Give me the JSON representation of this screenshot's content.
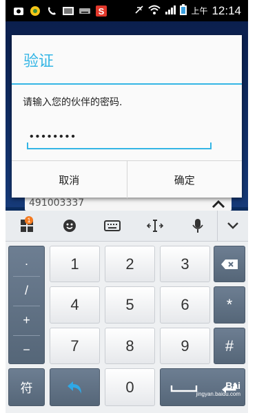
{
  "status_bar": {
    "left_icons": [
      "camera-icon",
      "sync-icon",
      "phone-icon",
      "image-icon",
      "keyboard-icon",
      "s-app-icon"
    ],
    "ampm": "上午",
    "time": "12:14"
  },
  "background": {
    "behind_input_value": "491003337"
  },
  "dialog": {
    "title": "验证",
    "message": "请输入您的伙伴的密码.",
    "password_value": "••••••••",
    "cancel_label": "取消",
    "confirm_label": "确定"
  },
  "keyboard": {
    "toolbar_badge": "1",
    "symbols": [
      ".",
      "/",
      "+",
      "−"
    ],
    "digits": [
      "1",
      "2",
      "3",
      "4",
      "5",
      "6",
      "7",
      "8",
      "9",
      "0"
    ],
    "star": "*",
    "hash": "#",
    "sym_label": "符"
  },
  "watermark": {
    "main": "Bai",
    "sub": "jingyan.baidu.com"
  },
  "colors": {
    "accent": "#33b5e5",
    "badge": "#f47a20"
  }
}
